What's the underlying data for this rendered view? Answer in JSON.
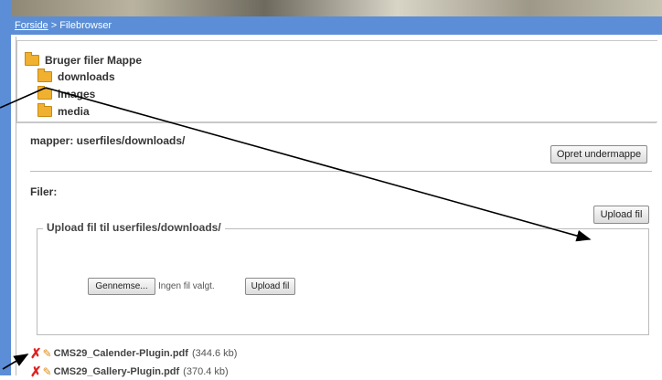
{
  "breadcrumb": {
    "home": "Forside",
    "separator": ">",
    "current": "Filebrowser"
  },
  "folder_tree": {
    "root": "Bruger filer Mappe",
    "children": [
      "downloads",
      "images",
      "media"
    ]
  },
  "folder_section": {
    "mapper_label": "mapper: userfiles/downloads/",
    "create_subfolder_button": "Opret undermappe"
  },
  "files_section": {
    "label": "Filer:",
    "upload_button": "Upload fil"
  },
  "upload_form": {
    "legend_prefix": "Upload fil til ",
    "legend_path": "userfiles/downloads/",
    "browse_button": "Gennemse...",
    "no_file_text": "Ingen fil valgt.",
    "submit_button": "Upload fil"
  },
  "files": [
    {
      "name": "CMS29_Calender-Plugin.pdf",
      "size": "(344.6 kb)"
    },
    {
      "name": "CMS29_Gallery-Plugin.pdf",
      "size": "(370.4 kb)"
    }
  ],
  "icons": {
    "folder": "folder-icon",
    "delete": "delete-x-icon",
    "edit": "edit-pencil-icon"
  },
  "colors": {
    "accent": "#5b8ed6",
    "folder": "#f0b030",
    "delete": "#e02020"
  }
}
